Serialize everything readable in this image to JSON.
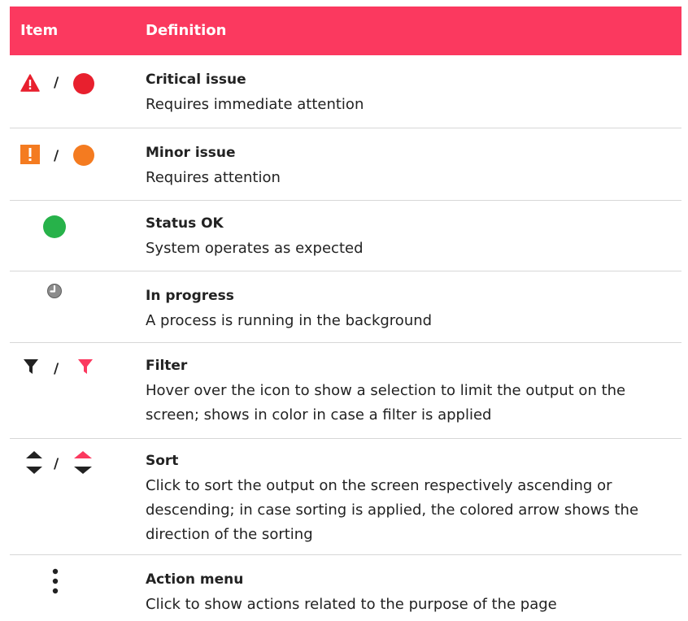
{
  "header": {
    "item_label": "Item",
    "definition_label": "Definition"
  },
  "colors": {
    "brand_pink": "#fb395f",
    "critical_red": "#e8202e",
    "minor_orange": "#f47b20",
    "ok_green": "#27b24a",
    "progress_gray": "#8c8c8c",
    "icon_dark": "#222222",
    "divider": "#d7d7d7"
  },
  "rows": [
    {
      "icons": [
        "warning-triangle-icon",
        "red-dot-icon"
      ],
      "separator": "/",
      "title": "Critical issue",
      "description": "Requires immediate attention"
    },
    {
      "icons": [
        "exclamation-square-icon",
        "orange-dot-icon"
      ],
      "separator": "/",
      "title": "Minor issue",
      "description": "Requires attention"
    },
    {
      "icons": [
        "green-dot-icon"
      ],
      "title": "Status OK",
      "description": "System operates as expected"
    },
    {
      "icons": [
        "clock-icon"
      ],
      "title": "In progress",
      "description": "A process is running in the background"
    },
    {
      "icons": [
        "filter-icon",
        "filter-active-icon"
      ],
      "separator": "/",
      "title": "Filter",
      "description": "Hover over the icon to show a selection to limit the output on the screen; shows in color in case a filter is applied"
    },
    {
      "icons": [
        "sort-icon",
        "sort-ascending-active-icon"
      ],
      "separator": "/",
      "title": "Sort",
      "description": "Click to sort the output on the screen respectively ascending or descending; in case sorting is applied, the colored arrow shows the direction of the sorting"
    },
    {
      "icons": [
        "vertical-dots-icon"
      ],
      "title": "Action menu",
      "description": "Click to show actions related to the purpose of the page"
    }
  ]
}
